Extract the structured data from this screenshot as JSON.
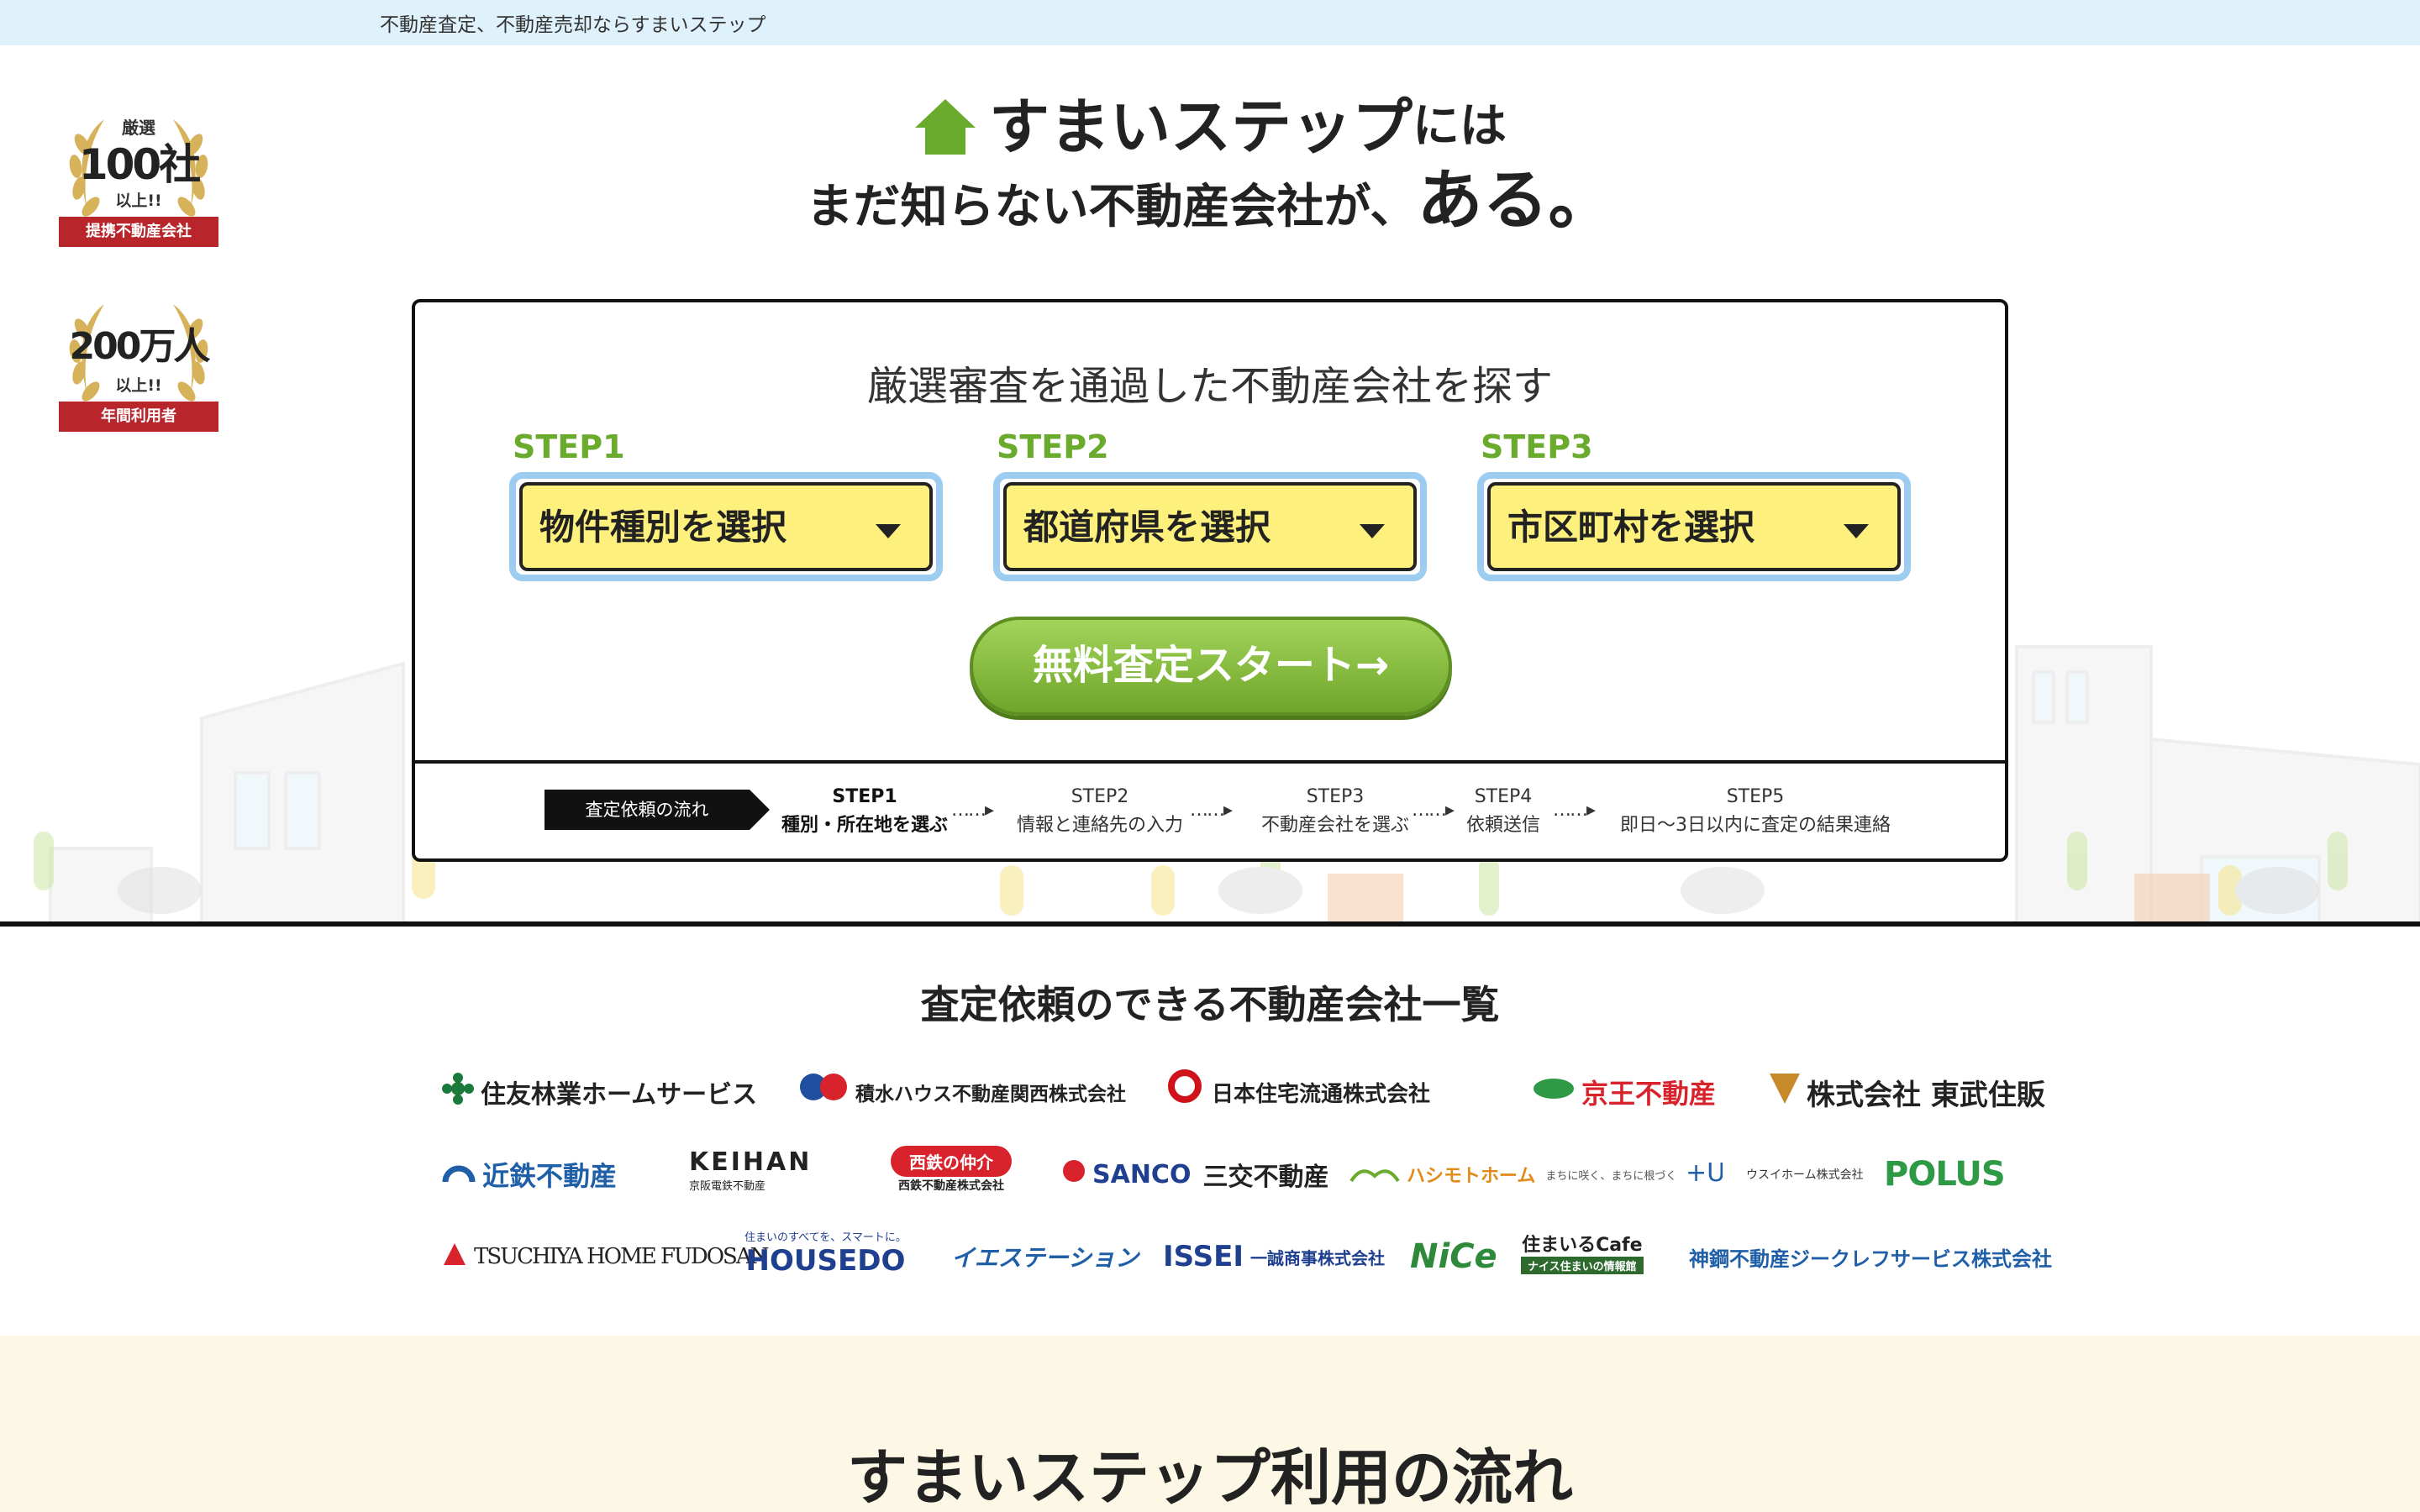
{
  "topbar": {
    "tagline": "不動産査定、不動産売却ならすまいステップ"
  },
  "badges": [
    {
      "top": "厳選",
      "number": "100社",
      "sub": "以上!!",
      "ribbon": "提携不動産会社"
    },
    {
      "top": "",
      "number": "200万人",
      "sub": "以上!!",
      "ribbon": "年間利用者"
    }
  ],
  "hero": {
    "brand": "すまいステップ",
    "brand_suffix": "には",
    "line2": "まだ知らない不動産会社が、",
    "line2_big": "ある。"
  },
  "search": {
    "title": "厳選審査を通過した不動産会社を探す",
    "steps": [
      {
        "label": "STEP1",
        "select": "物件種別を選択"
      },
      {
        "label": "STEP2",
        "select": "都道府県を選択"
      },
      {
        "label": "STEP3",
        "select": "市区町村を選択"
      }
    ],
    "start_button": "無料査定スタート→"
  },
  "flow": {
    "tag": "査定依頼の流れ",
    "steps": [
      {
        "num": "STEP1",
        "text": "種別・所在地を選ぶ"
      },
      {
        "num": "STEP2",
        "text": "情報と連絡先の入力"
      },
      {
        "num": "STEP3",
        "text": "不動産会社を選ぶ"
      },
      {
        "num": "STEP4",
        "text": "依頼送信"
      },
      {
        "num": "STEP5",
        "text": "即日〜3日以内に査定の結果連絡"
      }
    ],
    "dots": "……▸"
  },
  "companies": {
    "title": "査定依頼のできる不動産会社一覧",
    "logos": [
      "住友林業ホームサービス",
      "積水ハウス不動産関西株式会社",
      "日本住宅流通株式会社",
      "京王不動産",
      "株式会社 東武住販",
      "近鉄不動産",
      "KEIHAN",
      "京阪電鉄不動産",
      "西鉄の仲介",
      "西鉄不動産株式会社",
      "SANCO",
      "三交不動産",
      "ハシモトホーム",
      "まちに咲く、まちに根づく",
      "ウスイホーム株式会社",
      "POLUS",
      "TSUCHIYA HOME FUDOSAN",
      "住まいのすべてを、スマートに。",
      "HOUSEDO",
      "イエステーション",
      "ISSEI",
      "一誠商事株式会社",
      "NiCe",
      "住まいるCafe",
      "ナイス住まいの情報館",
      "神鋼不動産ジークレフサービス株式会社"
    ]
  },
  "flow_section": {
    "title": "すまいステップ利用の流れ"
  },
  "colors": {
    "accent_green": "#6aaa2c",
    "select_yellow": "#fdf07c",
    "select_border": "#9ccdf0",
    "ribbon_red": "#b8262b",
    "topbar": "#dff1fb",
    "bottom_bg": "#fdf8e6"
  }
}
